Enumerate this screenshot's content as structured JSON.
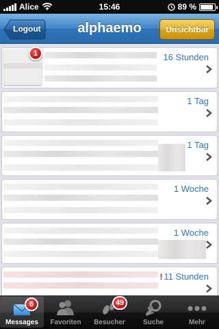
{
  "status_bar": {
    "carrier": "Alice",
    "time": "15:46",
    "battery_percent": "89 %",
    "battery_level": 0.89
  },
  "nav": {
    "title": "alphaemo",
    "left_button": "Logout",
    "right_button": "Unsichtbar"
  },
  "messages": [
    {
      "time": "16 Stunden",
      "unread_badge": "1",
      "urgent": false
    },
    {
      "time": "1 Tag",
      "unread_badge": "",
      "urgent": false
    },
    {
      "time": "1 Tag",
      "unread_badge": "",
      "urgent": false
    },
    {
      "time": "1 Woche",
      "unread_badge": "",
      "urgent": false
    },
    {
      "time": "1 Woche",
      "unread_badge": "",
      "urgent": false
    },
    {
      "time": "11 Stunden",
      "unread_badge": "",
      "urgent": true,
      "urgent_mark": "!"
    }
  ],
  "tabs": [
    {
      "label": "Messages",
      "icon": "envelope-icon",
      "badge": "6",
      "active": true
    },
    {
      "label": "Favoriten",
      "icon": "people-icon",
      "badge": "",
      "active": false
    },
    {
      "label": "Besucher",
      "icon": "footprints-icon",
      "badge": "49",
      "active": false
    },
    {
      "label": "Suche",
      "icon": "magnifier-icon",
      "badge": "",
      "active": false
    },
    {
      "label": "Mehr",
      "icon": "more-dots-icon",
      "badge": "",
      "active": false
    }
  ],
  "colors": {
    "nav_blue": "#3f85c9",
    "button_gold": "#e5b42a",
    "link_blue": "#2f78d0",
    "badge_red": "#c50d0d"
  }
}
